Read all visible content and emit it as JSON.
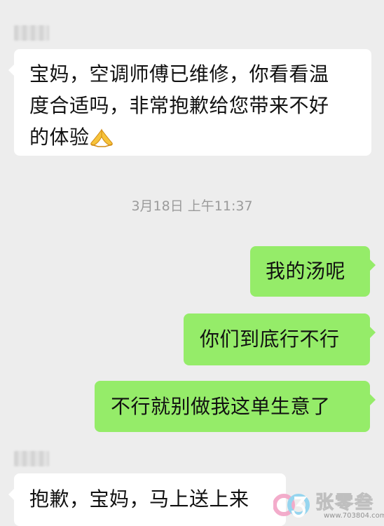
{
  "messages": [
    {
      "side": "received",
      "sender_blurred": true,
      "lines": [
        "宝妈，空调师傅已维修，你看看温",
        "度合适吗，非常抱歉给您带来不好",
        "的体验"
      ],
      "trailing_emoji": "folded-hands-icon"
    },
    {
      "side": "sent",
      "text": "我的汤呢"
    },
    {
      "side": "sent",
      "text": "你们到底行不行"
    },
    {
      "side": "sent",
      "text": "不行就别做我这单生意了"
    },
    {
      "side": "received",
      "sender_blurred": true,
      "text": "抱歉，宝妈，马上送上来"
    }
  ],
  "timestamp": "3月18日 上午11:37",
  "colors": {
    "background": "#ededed",
    "received_bubble": "#ffffff",
    "sent_bubble": "#95ec69",
    "timestamp_text": "#9b9b9b"
  },
  "watermark": {
    "name": "张零叁",
    "url": "www.703804.com"
  }
}
